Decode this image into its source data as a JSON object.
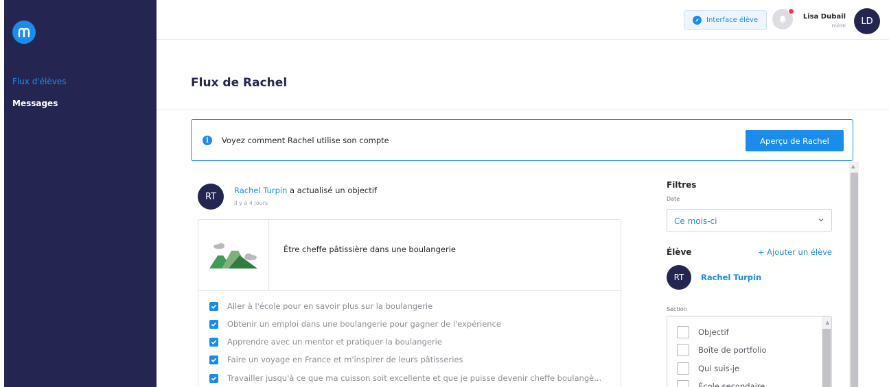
{
  "sidebar": {
    "items": [
      {
        "label": "Flux d'élèves"
      },
      {
        "label": "Messages"
      }
    ]
  },
  "topbar": {
    "student_interface_label": "Interface élève",
    "user_name": "Lisa Dubail",
    "user_role": "mère",
    "user_initials": "LD"
  },
  "page": {
    "title": "Flux de Rachel"
  },
  "banner": {
    "text": "Voyez comment Rachel utilise son compte",
    "button_label": "Aperçu de Rachel"
  },
  "feed": {
    "initials": "RT",
    "author": "Rachel Turpin",
    "action": " a actualisé un objectif",
    "time": "Il y a 4 jours",
    "goal_title": "Être cheffe pâtissière dans une boulangerie",
    "tasks": [
      "Aller à l'école pour en savoir plus sur la boulangerie",
      "Obtenir un emploi dans une boulangerie pour gagner de l'expérience",
      "Apprendre avec un mentor et pratiquer la boulangerie",
      "Faire un voyage en France et m'inspirer de leurs pâtisseries",
      "Travailler jusqu'à ce que ma cuisson soit excellente et que je puisse devenir cheffe boulangè..."
    ]
  },
  "filters": {
    "title": "Filtres",
    "date_label": "Date",
    "date_value": "Ce mois-ci",
    "eleve_label": "Élève",
    "add_eleve": "+ Ajouter un élève",
    "eleve_initials": "RT",
    "eleve_name": "Rachel Turpin",
    "section_label": "Section",
    "section_options": [
      "Objectif",
      "Boîte de portfolio",
      "Qui suis-je",
      "École secondaire"
    ]
  },
  "colors": {
    "accent": "#1a8cec",
    "navy": "#242651"
  }
}
